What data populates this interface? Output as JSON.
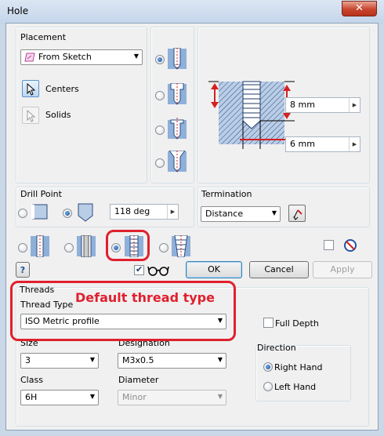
{
  "window": {
    "title": "Hole",
    "close_glyph": "✕"
  },
  "placement": {
    "label": "Placement",
    "source": "From Sketch",
    "centers_label": "Centers",
    "solids_label": "Solids"
  },
  "hole_types": [
    "drilled",
    "counterbore",
    "spotface",
    "countersink"
  ],
  "selected_hole_type": "drilled",
  "preview": {
    "depth_value": "8 mm",
    "diameter_value": "6 mm"
  },
  "drill_point": {
    "label": "Drill Point",
    "options": [
      "flat",
      "angle"
    ],
    "selected": "angle",
    "angle_value": "118 deg"
  },
  "termination": {
    "label": "Termination",
    "value": "Distance"
  },
  "thread_options": [
    "simple hole",
    "clearance hole",
    "tapped hole",
    "taper tapped hole"
  ],
  "selected_thread_option": "tapped hole",
  "buttons": {
    "help": "?",
    "ok": "OK",
    "cancel": "Cancel",
    "apply": "Apply"
  },
  "threads": {
    "group_label": "Threads",
    "thread_type_label": "Thread Type",
    "thread_type_value": "ISO Metric profile",
    "full_depth_label": "Full Depth",
    "size_label": "Size",
    "size_value": "3",
    "designation_label": "Designation",
    "designation_value": "M3x0.5",
    "class_label": "Class",
    "class_value": "6H",
    "diameter_label": "Diameter",
    "diameter_value": "Minor",
    "direction_label": "Direction",
    "right_hand_label": "Right Hand",
    "left_hand_label": "Left Hand",
    "direction_selected": "Right Hand"
  },
  "annotation": {
    "text": "Default thread type",
    "color": "#e0202e"
  }
}
